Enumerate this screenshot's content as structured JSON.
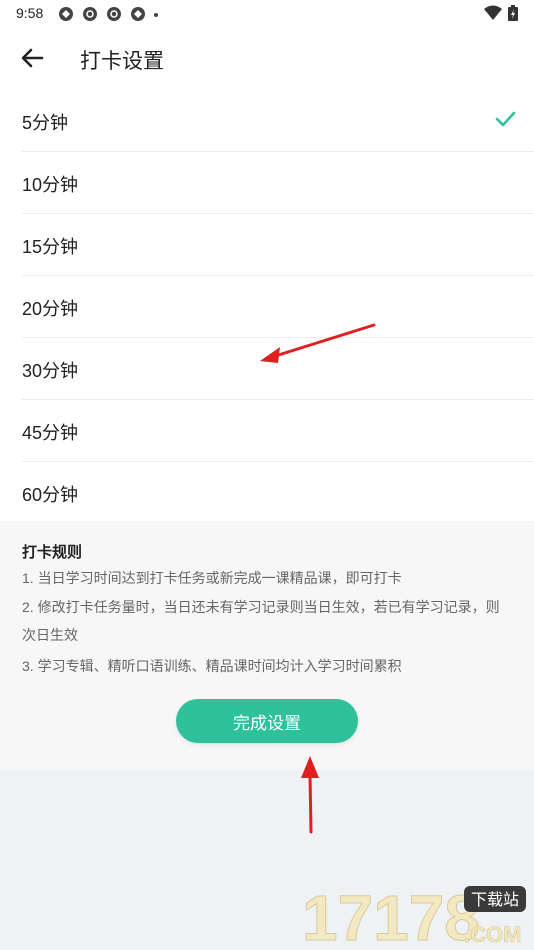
{
  "status_bar": {
    "time": "9:58"
  },
  "header": {
    "title": "打卡设置"
  },
  "options": [
    {
      "label": "5分钟",
      "selected": true
    },
    {
      "label": "10分钟",
      "selected": false
    },
    {
      "label": "15分钟",
      "selected": false
    },
    {
      "label": "20分钟",
      "selected": false
    },
    {
      "label": "30分钟",
      "selected": false
    },
    {
      "label": "45分钟",
      "selected": false
    },
    {
      "label": "60分钟",
      "selected": false
    }
  ],
  "rules": {
    "title": "打卡规则",
    "items": [
      "1. 当日学习时间达到打卡任务或新完成一课精品课，即可打卡",
      "2. 修改打卡任务量时，当日还未有学习记录则当日生效，若已有学习记录，则次日生效",
      "3. 学习专辑、精听口语训练、精品课时间均计入学习时间累积"
    ]
  },
  "done_button": {
    "label": "完成设置"
  },
  "watermark": {
    "text_main": "17178",
    "text_badge": "下载站",
    "text_com": ".COM"
  },
  "colors": {
    "accent": "#2ec19c",
    "annotation_arrow": "#e02020"
  }
}
